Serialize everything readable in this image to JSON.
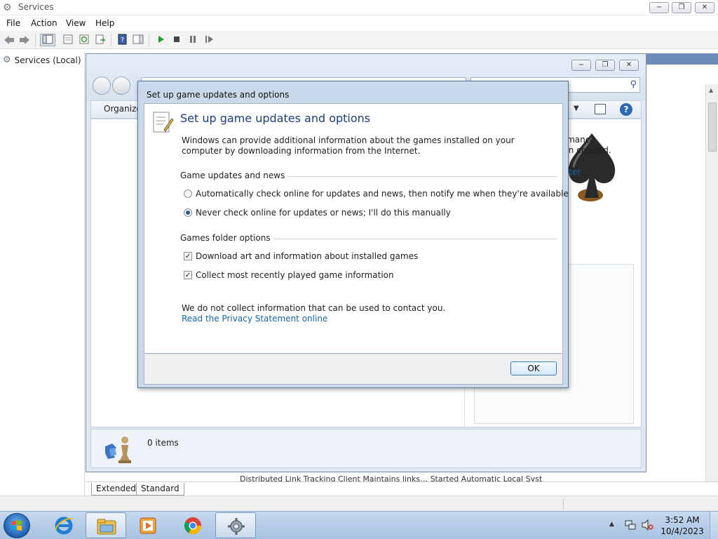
{
  "window": {
    "title": "Services",
    "min_glyph": "−",
    "max_glyph": "❐",
    "close_glyph": "✕"
  },
  "menu": [
    "File",
    "Action",
    "View",
    "Help"
  ],
  "tree": {
    "root_label": "Services (Local)"
  },
  "bottom_tabs": {
    "extended": "Extended",
    "standard": "Standard"
  },
  "peek_row_text": "Distributed Link Tracking Client      Maintains links…   Started   Automatic   Local Syst",
  "games_window": {
    "organize_label": "Organize",
    "items_count": "0 items",
    "perf_text_1": "ormance",
    "perf_text_2": "een created.",
    "perf_link_1": "puter",
    "perf_link_2": "e"
  },
  "dialog": {
    "title": "Set up game updates and options",
    "heading": "Set up game updates and options",
    "description": "Windows can provide additional information about the games installed on your computer by downloading information from the Internet.",
    "updates_group_label": "Game updates and news",
    "radio_auto": {
      "label": "Automatically check online for updates and news, then notify me when they're available",
      "selected": false
    },
    "radio_never": {
      "label": "Never check online for updates or news; I'll do this manually",
      "selected": true
    },
    "folder_group_label": "Games folder options",
    "check_art": {
      "label": "Download art and information about installed games",
      "checked": true
    },
    "check_recent": {
      "label": "Collect most recently played game information",
      "checked": true
    },
    "privacy_note": "We do not collect information that can be used to contact you.",
    "privacy_link": "Read the Privacy Statement online",
    "ok_label": "OK"
  },
  "taskbar": {
    "apps": [
      "internet-explorer",
      "windows-explorer",
      "media-player",
      "chrome",
      "services"
    ],
    "clock_time": "3:52 AM",
    "clock_date": "10/4/2023"
  },
  "colors": {
    "dialog_heading": "#1c3e7a",
    "link": "#1565a8",
    "taskbar": "#b7cde8"
  }
}
